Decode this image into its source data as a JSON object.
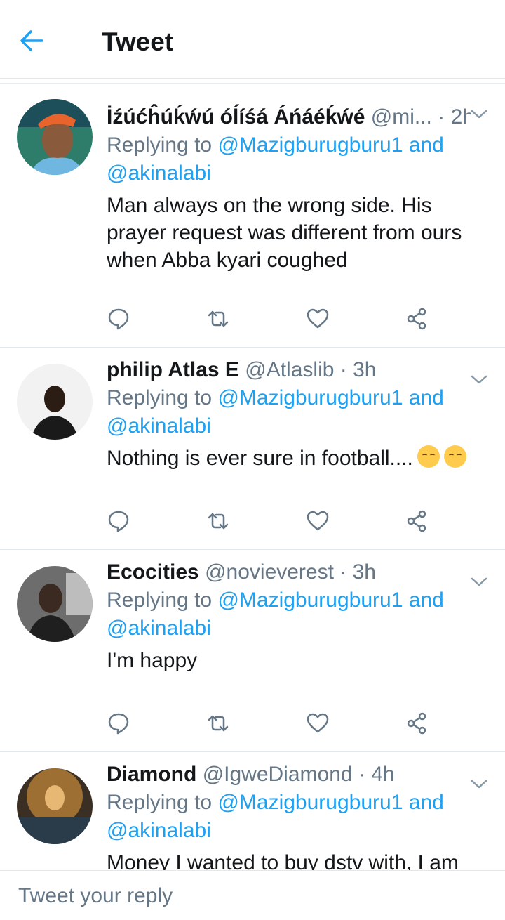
{
  "header": {
    "title": "Tweet",
    "back_icon": "arrow-left-icon",
    "accent": "#1da1f2"
  },
  "tweets": [
    {
      "name": "İźúćĥúḱẃú óĺíśá Áńáéḱẃé",
      "handle": "@mi...",
      "time": "· 2h",
      "replying_prefix": "Replying to ",
      "replying_link": "@Mazigburugburu1 and @akinalabi",
      "text": "Man always on the wrong side. His prayer request was different from ours when Abba kyari coughed"
    },
    {
      "name": "philip Atlas E",
      "handle": "@Atlaslib",
      "time": "· 3h",
      "replying_prefix": "Replying to ",
      "replying_link": "@Mazigburugburu1 and @akinalabi",
      "text": "Nothing is ever sure in football....",
      "emoji": "pensive-face-emoji"
    },
    {
      "name": "Ecocities",
      "handle": "@novieverest",
      "time": "· 3h",
      "replying_prefix": "Replying to ",
      "replying_link": "@Mazigburugburu1 and @akinalabi",
      "text": "I'm happy"
    },
    {
      "name": "Diamond",
      "handle": "@IgweDiamond",
      "time": "· 4h",
      "replying_prefix": "Replying to ",
      "replying_link": "@Mazigburugburu1 and @akinalabi",
      "text": "Money I wanted to buy dstv with, I am"
    }
  ],
  "actions": [
    "reply-icon",
    "retweet-icon",
    "like-icon",
    "share-icon"
  ],
  "reply_bar": {
    "placeholder": "Tweet your reply"
  },
  "colors": {
    "text": "#14171a",
    "secondary": "#657786",
    "link": "#1da1f2",
    "divider": "#e1e8ed"
  }
}
